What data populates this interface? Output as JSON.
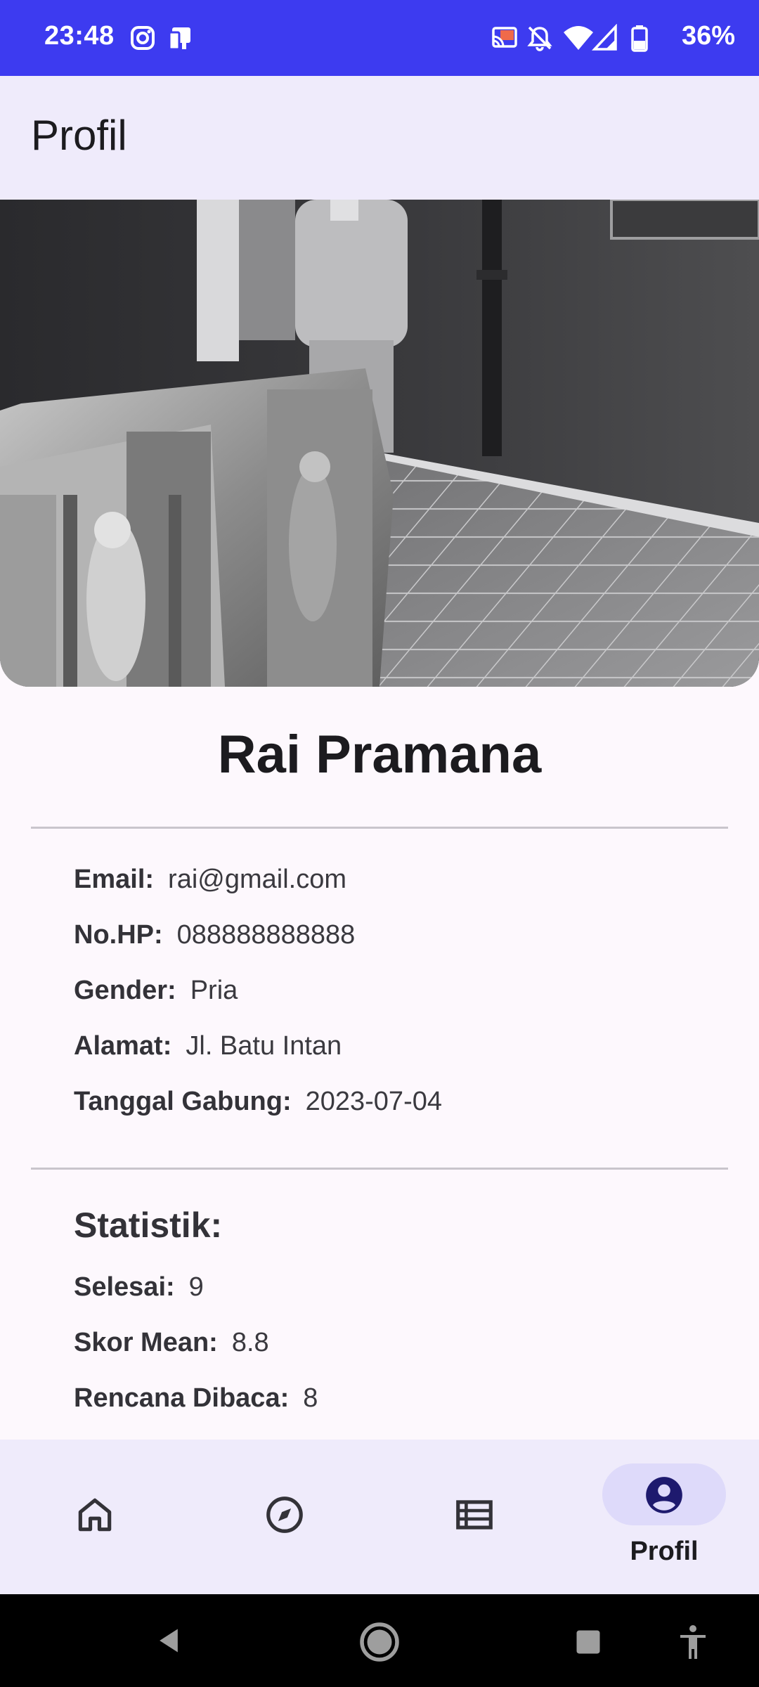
{
  "status_bar": {
    "time": "23:48",
    "battery": "36%",
    "icons": [
      "instagram-icon",
      "notification-app-icon",
      "cast-icon",
      "bell-off-icon",
      "wifi-icon",
      "signal-icon",
      "battery-icon"
    ]
  },
  "app_bar": {
    "title": "Profil"
  },
  "profile": {
    "name": "Rai Pramana",
    "details": [
      {
        "label": "Email:",
        "value": "rai@gmail.com"
      },
      {
        "label": "No.HP:",
        "value": "088888888888"
      },
      {
        "label": "Gender:",
        "value": "Pria"
      },
      {
        "label": "Alamat:",
        "value": "Jl. Batu Intan"
      },
      {
        "label": "Tanggal Gabung:",
        "value": "2023-07-04"
      }
    ]
  },
  "stats": {
    "title": "Statistik:",
    "items": [
      {
        "label": "Selesai:",
        "value": "9"
      },
      {
        "label": "Skor Mean:",
        "value": "8.8"
      },
      {
        "label": "Rencana Dibaca:",
        "value": "8"
      }
    ]
  },
  "bottom_nav": {
    "items": [
      {
        "icon": "home-icon",
        "label": ""
      },
      {
        "icon": "compass-icon",
        "label": ""
      },
      {
        "icon": "list-icon",
        "label": ""
      },
      {
        "icon": "profile-icon",
        "label": "Profil",
        "selected": true
      }
    ]
  },
  "system_nav": {
    "icons": [
      "back-icon",
      "home-circle-icon",
      "recents-icon",
      "accessibility-icon"
    ]
  },
  "colors": {
    "status_bar": "#3d3bf0",
    "app_bar": "#efebfb",
    "background": "#fdf8fd",
    "nav_pill": "#dedafa",
    "profile_icon": "#1e1a6e"
  }
}
